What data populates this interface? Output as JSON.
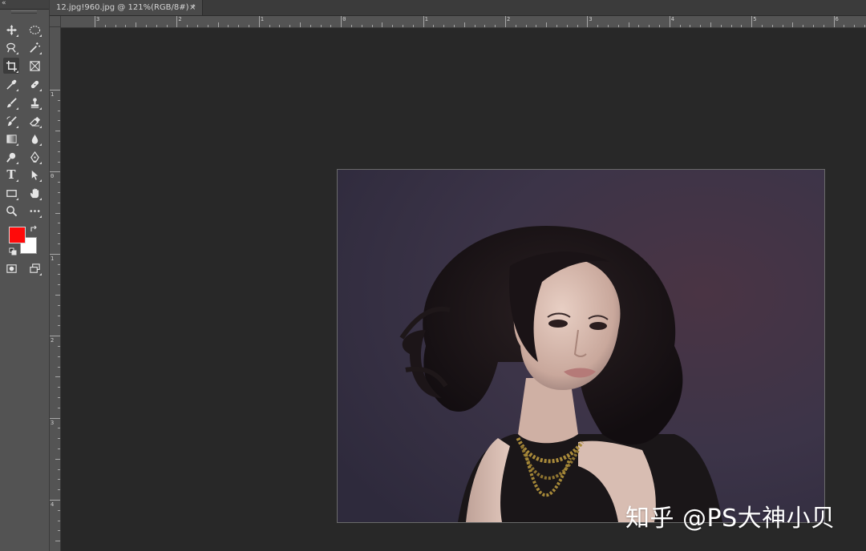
{
  "document_tab": {
    "title": "12.jpg!960.jpg @ 121%(RGB/8#) *",
    "close_label": "×"
  },
  "tools_panel": {
    "collapse_label": "«",
    "tools": [
      {
        "name": "move-tool-icon"
      },
      {
        "name": "elliptical-marquee-tool-icon"
      },
      {
        "name": "quick-selection-tool-icon"
      },
      {
        "name": "magic-wand-tool-icon"
      },
      {
        "name": "crop-tool-icon"
      },
      {
        "name": "frame-tool-icon"
      },
      {
        "name": "eyedropper-tool-icon"
      },
      {
        "name": "healing-brush-tool-icon"
      },
      {
        "name": "brush-tool-icon"
      },
      {
        "name": "clone-stamp-tool-icon"
      },
      {
        "name": "history-brush-tool-icon"
      },
      {
        "name": "eraser-tool-icon"
      },
      {
        "name": "gradient-tool-icon"
      },
      {
        "name": "blur-tool-icon"
      },
      {
        "name": "dodge-tool-icon"
      },
      {
        "name": "pen-tool-icon"
      },
      {
        "name": "type-tool-icon"
      },
      {
        "name": "path-selection-tool-icon"
      },
      {
        "name": "rectangle-tool-icon"
      },
      {
        "name": "hand-tool-icon"
      },
      {
        "name": "zoom-tool-icon"
      },
      {
        "name": "more-tools-icon"
      },
      {
        "name": "quick-mask-icon"
      },
      {
        "name": "screen-mode-icon"
      }
    ],
    "type_tool_glyph": "T",
    "foreground_color": "#ff0a0a",
    "background_color": "#ffffff"
  },
  "rulers": {
    "top_labels": [
      "3",
      "2",
      "1",
      "0",
      "1",
      "2",
      "3",
      "4",
      "5",
      "6"
    ],
    "left_labels": [
      "1",
      "0",
      "1",
      "2",
      "3",
      "4"
    ]
  },
  "canvas": {
    "image_description_icon": "portrait-photo"
  },
  "watermark": {
    "text": "知乎 @PS大神小贝"
  }
}
